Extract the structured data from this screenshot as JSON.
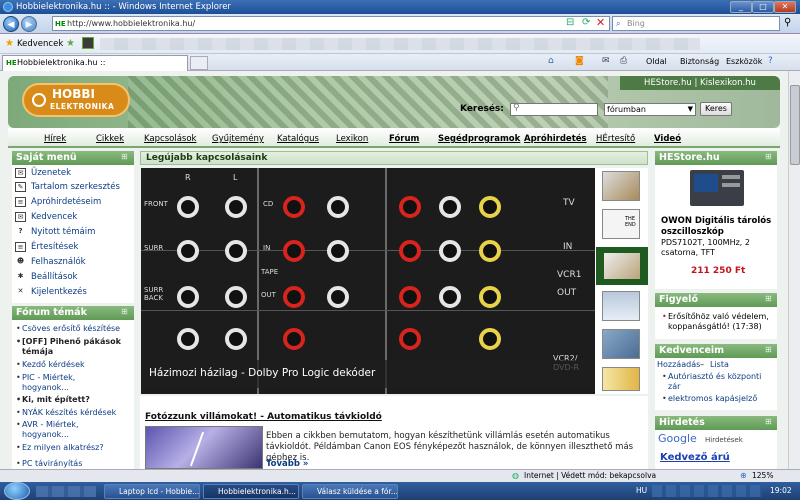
{
  "window": {
    "title": "Hobbielektronika.hu :: - Windows Internet Explorer"
  },
  "address": {
    "url": "http://www.hobbielektronika.hu/",
    "search_placeholder": "Bing",
    "badge": "HE"
  },
  "favorites": {
    "label": "Kedvencek"
  },
  "tab": {
    "title": "Hobbielektronika.hu ::"
  },
  "commandbar": {
    "page": "Oldal",
    "security": "Biztonság",
    "tools": "Eszközök"
  },
  "site": {
    "toplinks": [
      "HEStore.hu",
      "Kislexikon.hu"
    ],
    "logo_top": "HOBBI",
    "logo_bottom": "ELEKTRONIKA",
    "search_label": "Keresés:",
    "search_scope": "fórumban",
    "search_button": "Keres",
    "menu": [
      "Hírek",
      "Cikkek",
      "Kapcsolások",
      "Gyűjtemény",
      "Katalógus",
      "Lexikon",
      "Fórum",
      "Segédprogramok",
      "Apróhirdetés",
      "HÉrtesítő",
      "Videó"
    ],
    "own_menu": {
      "title": "Saját menü",
      "items": [
        "Üzenetek",
        "Tartalom szerkesztés",
        "Apróhirdetéseim",
        "Kedvencek",
        "Nyitott témáim",
        "Értesítések",
        "Felhasználók",
        "Beállítások",
        "Kijelentkezés"
      ]
    },
    "forum": {
      "title": "Fórum témák",
      "items": [
        "Csöves erősítő készítése",
        "[OFF] Pihenő pákások témája",
        "Kezdő kérdések",
        "PIC - Miértek, hogyanok...",
        "Ki, mit épített?",
        "NYÁK készítés kérdések",
        "AVR - Miértek, hogyanok...",
        "Ez milyen alkatrész?",
        "PC távirányítás"
      ]
    },
    "center": {
      "header": "Legújabb kapcsolásaink",
      "slide_caption": "Házimozi házilag - Dolby Pro Logic dekóder",
      "panel_labels": {
        "r": "R",
        "l": "L",
        "front": "FRONT",
        "surr": "SURR",
        "surr_back": "SURR BACK",
        "cd": "CD",
        "in": "IN",
        "tape": "TAPE",
        "out": "OUT",
        "tv": "TV",
        "vcr1": "VCR1",
        "vcr2": "VCR2/ DVD-R"
      },
      "article_title": "Fotózzunk villámokat! - Automatikus távkioldó",
      "article_text": "Ebben a cikkben bemutatom, hogyan készíthetünk villámlás esetén automatikus távkioldót. Példámban Canon EOS fényképezőt használok, de könnyen illeszthető más géphez is.",
      "more": "Tovább »",
      "thumb_the_end": "THE END"
    },
    "hestore": {
      "title": "HEStore.hu",
      "product": "OWON Digitális tárolós oszcilloszkóp",
      "desc": "PDS7102T, 100MHz, 2 csatorna, TFT",
      "price": "211 250 Ft"
    },
    "watch": {
      "title": "Figyelő",
      "items": [
        "Erősítőhöz való védelem, koppanásgátló! (17:38)"
      ]
    },
    "favs": {
      "title": "Kedvenceim",
      "add": "Hozzáadás",
      "list": "Lista",
      "items": [
        "Autóriasztó és központi zár",
        "elektromos kapásjelző"
      ]
    },
    "ads": {
      "title": "Hirdetés",
      "google": "Google",
      "google_sub": "Hirdetések",
      "headline": "Kedvező árú"
    }
  },
  "status": {
    "zone": "Internet | Védett mód: bekapcsolva",
    "zoom": "125%"
  },
  "taskbar": {
    "tasks": [
      "Laptop lcd - Hobbie...",
      "Hobbielektronika.h...",
      "Válasz küldése a fór..."
    ],
    "lang": "HU",
    "clock": "19:02"
  },
  "colors": {
    "accent": "#5f9a55",
    "link": "#0c3c84",
    "price": "#c0151b",
    "logo": "#d98b1a"
  }
}
